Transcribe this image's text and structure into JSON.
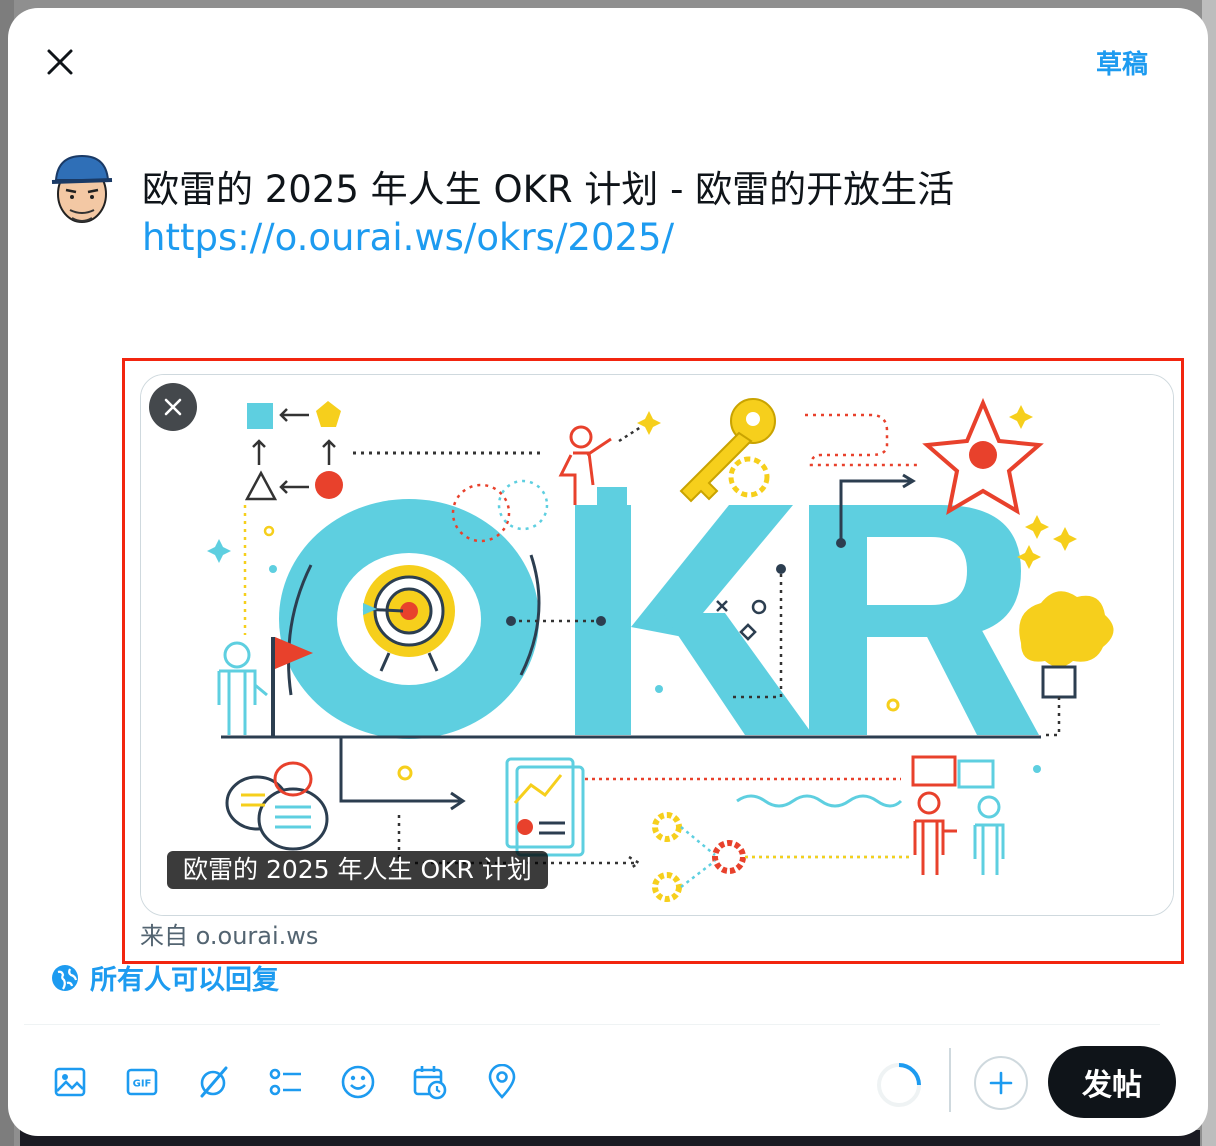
{
  "header": {
    "close_icon": "close-icon",
    "drafts_label": "草稿"
  },
  "composer": {
    "text": "欧雷的 2025 年人生 OKR 计划 - 欧雷的开放生活",
    "link": "https://o.ourai.ws/okrs/2025/"
  },
  "link_card": {
    "remove_icon": "close-icon",
    "title": "欧雷的 2025 年人生 OKR 计划",
    "source": "来自 o.ourai.ws",
    "image_letters": "OKR"
  },
  "reply_setting": {
    "icon": "globe-icon",
    "label": "所有人可以回复"
  },
  "toolbar": {
    "tools": [
      "image-icon",
      "gif-icon",
      "grok-icon",
      "poll-icon",
      "emoji-icon",
      "schedule-icon",
      "location-icon"
    ]
  },
  "actions": {
    "add_icon": "plus-icon",
    "post_label": "发帖"
  },
  "colors": {
    "accent": "#1d9bf0",
    "highlight": "#f2250f",
    "post_button": "#0f1419",
    "okr_teal": "#5ecfe0",
    "okr_red": "#e8412c",
    "okr_yellow": "#f6cf1c"
  }
}
